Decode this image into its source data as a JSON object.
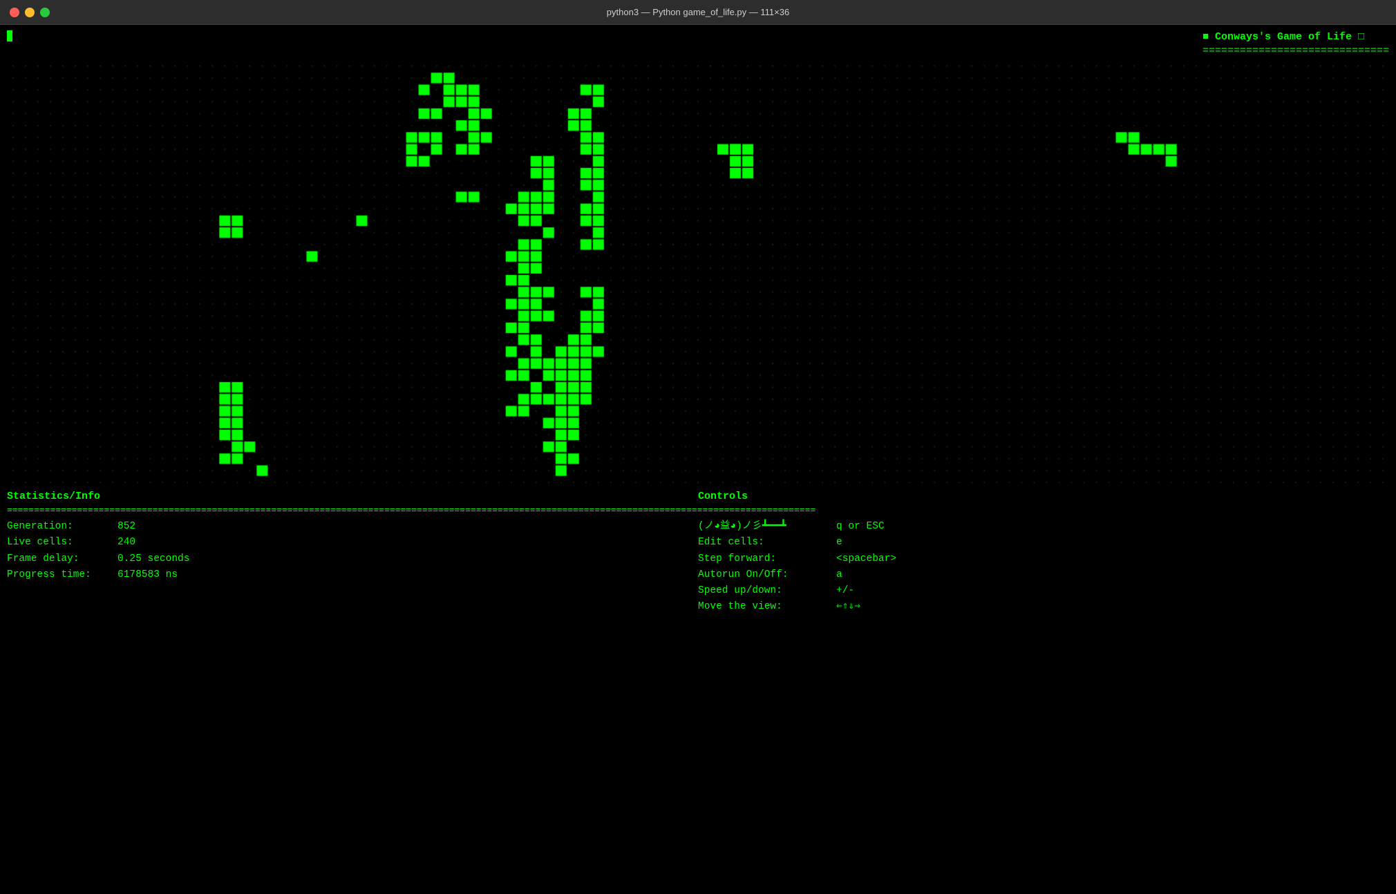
{
  "titlebar": {
    "title": "python3 — Python game_of_life.py — 111×36"
  },
  "header": {
    "title": "■ Conways's Game of Life □",
    "equals": "=============================="
  },
  "stats": {
    "generation_label": "Generation:",
    "generation_value": "852",
    "live_cells_label": "Live cells:",
    "live_cells_value": "240",
    "frame_delay_label": "Frame delay:",
    "frame_delay_value": "0.25 seconds",
    "progress_label": "Progress time:",
    "progress_value": "6178583 ns"
  },
  "controls": {
    "quit_label": "(ノ◕益◕)ノ彡┻━━┻",
    "quit_value": "q or ESC",
    "edit_label": "Edit cells:",
    "edit_value": "e",
    "step_label": "Step forward:",
    "step_value": "<spacebar>",
    "autorun_label": "Autorun On/Off:",
    "autorun_value": "a",
    "speed_label": "Speed up/down:",
    "speed_value": "+/-",
    "move_label": "Move the view:",
    "move_value": "⇐⇑⇓⇒"
  },
  "section_headers": {
    "left": "Statistics/Info",
    "right": "Controls"
  },
  "divider": "======================================================================================================================================================",
  "cursor_visible": true
}
